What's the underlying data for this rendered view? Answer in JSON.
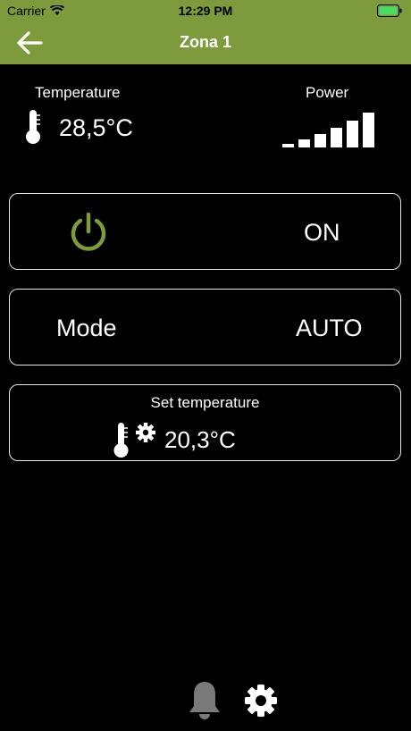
{
  "status_bar": {
    "carrier": "Carrier",
    "time": "12:29 PM"
  },
  "nav": {
    "title": "Zona 1",
    "back_icon": "arrow-left-icon"
  },
  "temperature": {
    "label": "Temperature",
    "value": "28,5°C",
    "icon": "thermometer-icon"
  },
  "power": {
    "label": "Power",
    "level_bars_filled": 6,
    "level_bars_total": 6
  },
  "power_card": {
    "icon": "power-icon",
    "state": "ON",
    "icon_color": "#7d9a3c"
  },
  "mode_card": {
    "label": "Mode",
    "value": "AUTO"
  },
  "set_temperature_card": {
    "label": "Set temperature",
    "value": "20,3°C",
    "icon": "thermometer-gear-icon"
  },
  "bottom_bar": {
    "icons": [
      "bell-icon",
      "gear-icon"
    ]
  },
  "colors": {
    "header": "#7d9a3c",
    "accent": "#7d9a3c",
    "background": "#000000",
    "bell_disabled": "#7a7a7a"
  }
}
